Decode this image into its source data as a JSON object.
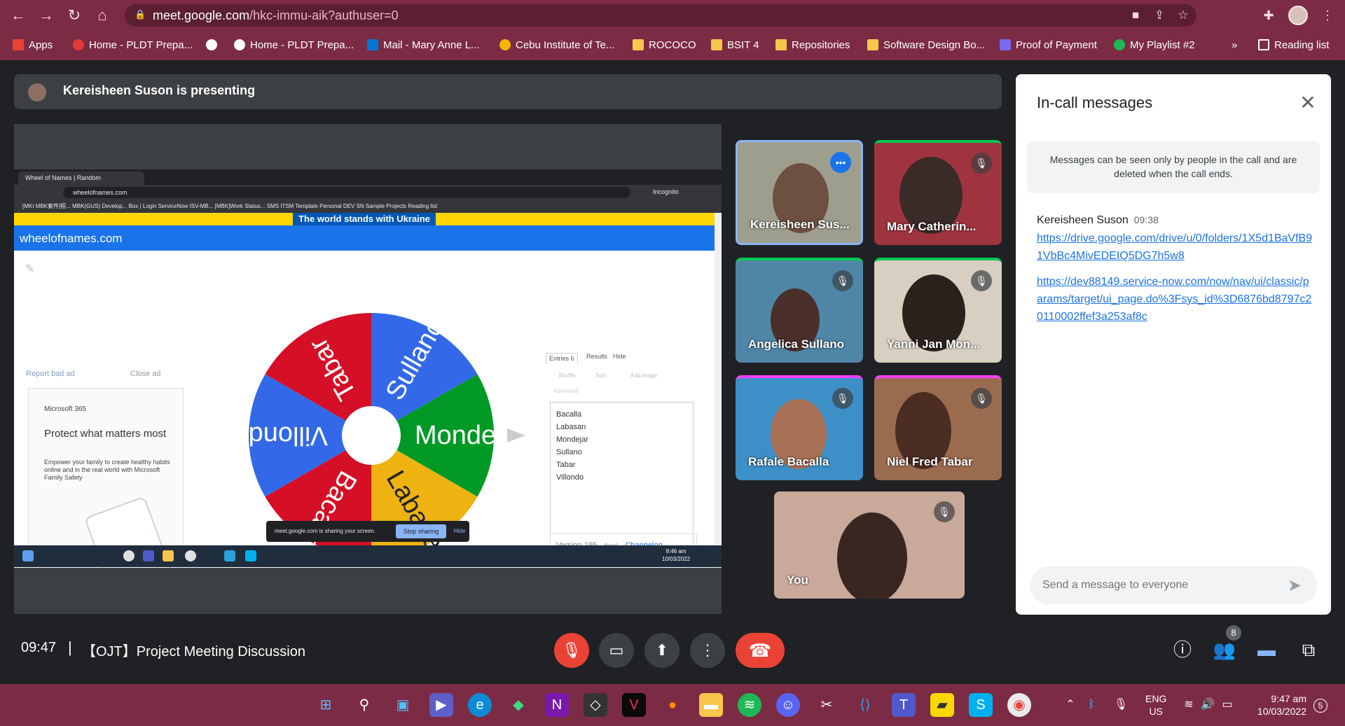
{
  "browser": {
    "url_host": "meet.google.com",
    "url_path": "/hkc-immu-aik?authuser=0",
    "bookmarks": [
      {
        "label": "Apps",
        "color": "#ea4335"
      },
      {
        "label": "Home - PLDT Prepa...",
        "color": "#e53935"
      },
      {
        "label": "",
        "color": "#ffffff"
      },
      {
        "label": "Home - PLDT Prepa...",
        "color": "#ffffff"
      },
      {
        "label": "Mail - Mary Anne L...",
        "color": "#0078d4"
      },
      {
        "label": "Cebu Institute of Te...",
        "color": "#f4b400"
      },
      {
        "label": "ROCOCO",
        "color": "#f6c64d"
      },
      {
        "label": "BSIT 4",
        "color": "#f6c64d"
      },
      {
        "label": "Repositories",
        "color": "#f6c64d"
      },
      {
        "label": "Software Design Bo...",
        "color": "#f6c64d"
      },
      {
        "label": "Proof of Payment",
        "color": "#7b68ee"
      },
      {
        "label": "My Playlist #2",
        "color": "#1db954"
      }
    ],
    "more": "»",
    "reading_list": "Reading list"
  },
  "presenting": {
    "text": "Kereisheen Suson is presenting"
  },
  "shared_screen": {
    "tab_title": "Wheel of Names | Random",
    "url": "wheelofnames.com",
    "incognito": "Incognito",
    "bookmarks_line": "[MKI MBK案件]程...   MBK(GUS) Develop...   Box | Login   ServiceNow ISV-MB...   [MBK]Work Status...   SMS   ITSM Template   Personal DEV   SN Sample Projects        Reading list",
    "banner": "The world stands with Ukraine",
    "site_title": "wheelofnames.com",
    "report_ad": "Report bad ad",
    "close_ad": "Close ad",
    "ad_brand": "Microsoft 365",
    "ad_headline": "Protect what matters most",
    "ad_body": "Empower your family to create healthy habits online and in the real world with Microsoft Family Safety",
    "wheel_labels": [
      "Sullano",
      "Mondejar",
      "Labasan",
      "Bacalla",
      "Villondo",
      "Tabar"
    ],
    "wheel_colors": [
      "#3369e8",
      "#009925",
      "#eeb211",
      "#d50f25",
      "#3369e8",
      "#d50f25"
    ],
    "tab_entries": "Entries",
    "entries_count": "6",
    "tab_results": "Results",
    "tab_hide": "Hide",
    "shuffle": "Shuffle",
    "sort": "Sort",
    "add_image": "Add image",
    "advanced": "Advanced",
    "entries": [
      "Bacalla",
      "Labasan",
      "Mondejar",
      "Sullano",
      "Tabar",
      "Villondo"
    ],
    "version": "Version 195",
    "new_badge": "New!",
    "changelog": "Changelog",
    "sharing_text": "meet.google.com is sharing your screen.",
    "stop_sharing": "Stop sharing",
    "hide": "Hide",
    "taskbar_time": "9:46 am",
    "taskbar_date": "10/03/2022"
  },
  "participants": [
    {
      "name": "Kereisheen Sus...",
      "muted": false,
      "bg": "#9e9e8e",
      "border": "#8ab4f8"
    },
    {
      "name": "Mary Catherin...",
      "muted": true,
      "bg": "#a0343e",
      "border": "#00c853"
    },
    {
      "name": "Angelica Sullano",
      "muted": true,
      "bg": "#4f86a8",
      "border": "#00c853"
    },
    {
      "name": "Yanni Jan Mon...",
      "muted": true,
      "bg": "#d8cfc2",
      "border": "#00c853"
    },
    {
      "name": "Rafale Bacalla",
      "muted": true,
      "bg": "#3d8fc7",
      "border": "#ff40ff"
    },
    {
      "name": "Niel Fred Tabar",
      "muted": true,
      "bg": "#9b6b50",
      "border": "#ff40ff"
    },
    {
      "name": "You",
      "muted": true,
      "bg": "#c9a99a",
      "border": "none"
    }
  ],
  "chat": {
    "title": "In-call messages",
    "note": "Messages can be seen only by people in the call and are deleted when the call ends.",
    "sender": "Kereisheen Suson",
    "time": "09:38",
    "link1": "https://drive.google.com/drive/u/0/folders/1X5d1BaVfB91VbBc4MivEDEIQ5DG7h5w8",
    "link2": "https://dev88149.service-now.com/now/nav/ui/classic/params/target/ui_page.do%3Fsys_id%3D6876bd8797c20110002ffef3a253af8c",
    "input_placeholder": "Send a message to everyone"
  },
  "meeting": {
    "time": "09:47",
    "separator": "|",
    "title": "【OJT】Project Meeting Discussion",
    "people_count": "8"
  },
  "taskbar": {
    "lang1": "ENG",
    "lang2": "US",
    "time": "9:47 am",
    "date": "10/03/2022",
    "notifications": "5"
  }
}
